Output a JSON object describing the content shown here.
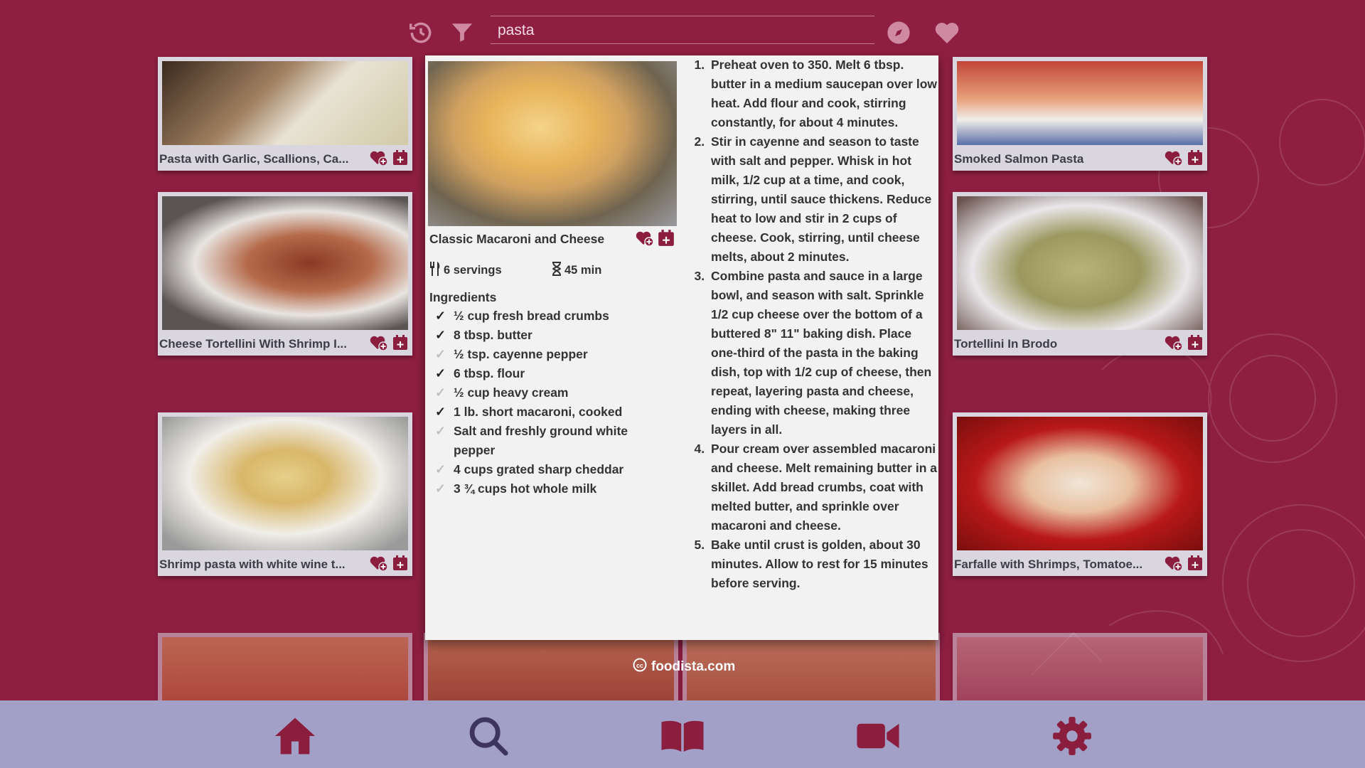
{
  "search": {
    "value": "pasta"
  },
  "colors": {
    "background": "#8f1f42",
    "accent": "#8b1d3f",
    "nav_bar": "#a3a0c7",
    "card": "#dad6df"
  },
  "toolbar": {
    "icons": [
      "history-icon",
      "filter-icon",
      "explore-icon",
      "favorites-icon"
    ]
  },
  "cards": [
    {
      "title": "Pasta with Garlic, Scallions, Ca..."
    },
    {
      "title": "Cheese Tortellini With Shrimp I..."
    },
    {
      "title": "Shrimp pasta with white wine t..."
    },
    {
      "title": "Smoked Salmon Pasta"
    },
    {
      "title": "Tortellini In Brodo"
    },
    {
      "title": "Farfalle with Shrimps, Tomatoe..."
    }
  ],
  "detail": {
    "title": "Classic Macaroni and Cheese",
    "servings": "6 servings",
    "time": "45 min",
    "ingredients_heading": "Ingredients",
    "ingredients": [
      {
        "text": "½ cup fresh bread crumbs",
        "checked": true
      },
      {
        "text": "8 tbsp. butter",
        "checked": true
      },
      {
        "text": "½ tsp. cayenne pepper",
        "checked": false
      },
      {
        "text": "6 tbsp. flour",
        "checked": true
      },
      {
        "text": "½ cup heavy cream",
        "checked": false
      },
      {
        "text": "1 lb. short macaroni, cooked",
        "checked": true
      },
      {
        "text": "Salt and freshly ground white pepper",
        "checked": false
      },
      {
        "text": "4 cups grated sharp cheddar",
        "checked": false
      },
      {
        "text": "3 ¾ cups hot whole milk",
        "checked": false
      }
    ],
    "steps": [
      "Preheat oven to 350. Melt 6 tbsp. butter in a medium saucepan over low heat. Add flour and cook, stirring constantly, for about 4 minutes.",
      "Stir in cayenne and season to taste with salt and pepper. Whisk in hot milk, 1/2 cup at a time, and cook, stirring, until sauce thickens. Reduce heat to low and stir in 2 cups of cheese. Cook, stirring, until cheese melts, about 2 minutes.",
      "Combine pasta and sauce in a large bowl, and season with salt. Sprinkle 1/2 cup cheese over the bottom of a buttered 8\" 11\" baking dish. Place one-third of the pasta in the baking dish, top with 1/2 cup of cheese, then repeat, layering pasta and cheese, ending with cheese, making three layers in all.",
      "Pour cream over assembled macaroni and cheese. Melt remaining butter in a skillet. Add bread crumbs, coat with melted butter, and sprinkle over macaroni and cheese.",
      "Bake until crust is golden, about 30 minutes. Allow to rest for 15 minutes before serving."
    ]
  },
  "source": {
    "label": "foodista.com"
  },
  "nav": {
    "items": [
      "home-icon",
      "search-icon",
      "book-icon",
      "video-icon",
      "settings-icon"
    ]
  }
}
